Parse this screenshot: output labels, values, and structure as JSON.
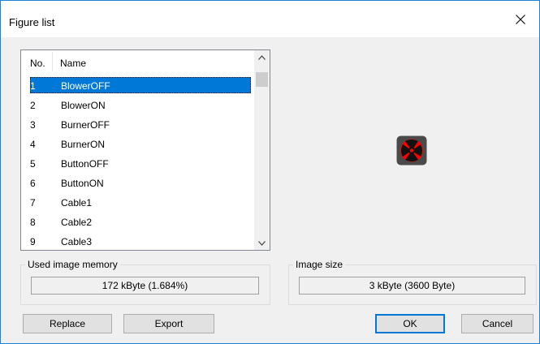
{
  "window": {
    "title": "Figure list"
  },
  "list": {
    "headers": {
      "no": "No.",
      "name": "Name"
    },
    "rows": [
      {
        "no": "1",
        "name": "BlowerOFF",
        "selected": true
      },
      {
        "no": "2",
        "name": "BlowerON"
      },
      {
        "no": "3",
        "name": "BurnerOFF"
      },
      {
        "no": "4",
        "name": "BurnerON"
      },
      {
        "no": "5",
        "name": "ButtonOFF"
      },
      {
        "no": "6",
        "name": "ButtonON"
      },
      {
        "no": "7",
        "name": "Cable1"
      },
      {
        "no": "8",
        "name": "Cable2"
      },
      {
        "no": "9",
        "name": "Cable3"
      }
    ]
  },
  "memory": {
    "label": "Used image memory",
    "value": "172 kByte (1.684%)"
  },
  "image_size": {
    "label": "Image size",
    "value": "3 kByte (3600 Byte)"
  },
  "buttons": {
    "replace": "Replace",
    "export": "Export",
    "ok": "OK",
    "cancel": "Cancel"
  },
  "preview": {
    "icon": "blower-off-icon"
  },
  "colors": {
    "selection": "#0078d7",
    "preview_red": "#ff0000",
    "preview_bg": "#4a4a4a",
    "window_border": "#1883d7"
  }
}
